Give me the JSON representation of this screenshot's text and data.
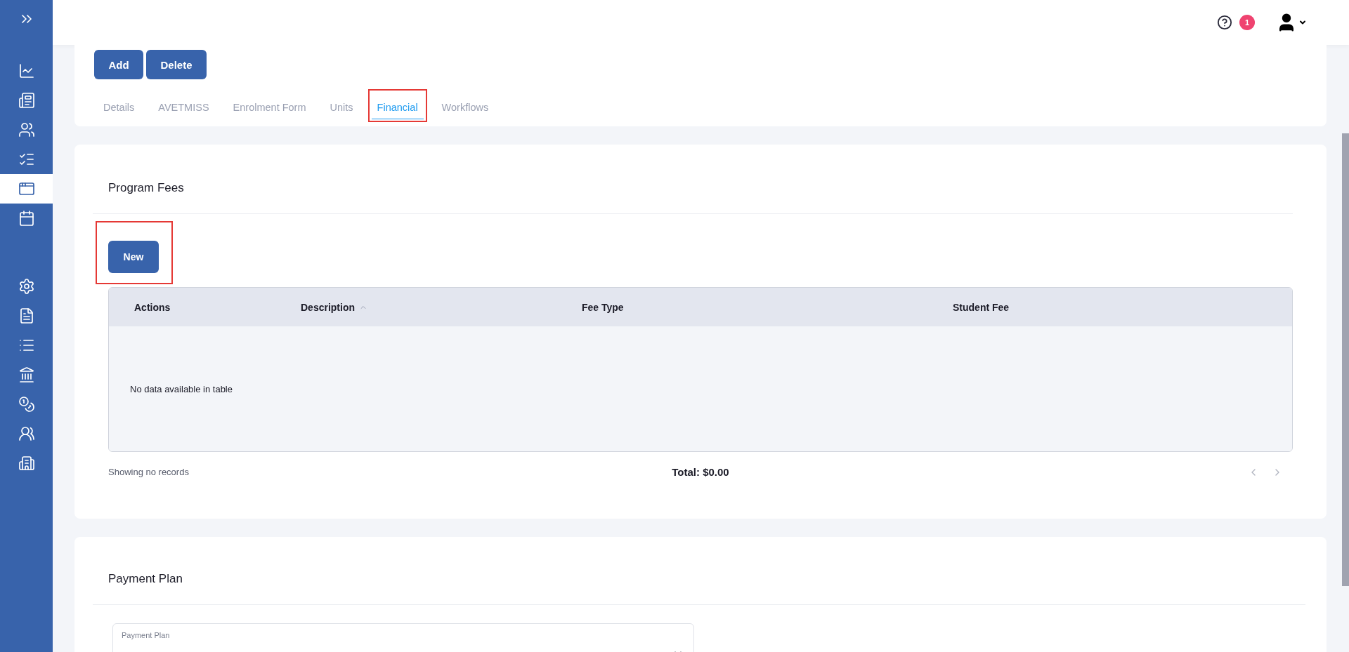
{
  "sidebar": {
    "items": [
      {
        "selected": false
      },
      {
        "selected": false
      },
      {
        "selected": false
      },
      {
        "selected": false
      },
      {
        "selected": false
      },
      {
        "selected": true
      },
      {
        "selected": false
      },
      {
        "selected": false
      },
      {
        "selected": false
      },
      {
        "selected": false
      },
      {
        "selected": false
      },
      {
        "selected": false
      },
      {
        "selected": false
      },
      {
        "selected": false
      }
    ]
  },
  "top_bar": {
    "notification_count": "1"
  },
  "header": {
    "buttons": [
      "Add",
      "Delete"
    ],
    "tabs": [
      {
        "label": "Details",
        "selected": false,
        "highlighted": false
      },
      {
        "label": "AVETMISS",
        "selected": false,
        "highlighted": false
      },
      {
        "label": "Enrolment Form",
        "selected": false,
        "highlighted": false
      },
      {
        "label": "Units",
        "selected": false,
        "highlighted": false
      },
      {
        "label": "Financial",
        "selected": true,
        "highlighted": true
      },
      {
        "label": "Workflows",
        "selected": false,
        "highlighted": false
      }
    ]
  },
  "program_fees": {
    "title": "Program Fees",
    "new_button": {
      "label": "New",
      "highlighted": true
    },
    "table": {
      "columns": [
        {
          "label": "Actions",
          "sorted": false
        },
        {
          "label": "Description",
          "sorted": true
        },
        {
          "label": "Fee Type",
          "sorted": false
        },
        {
          "label": "Student Fee",
          "sorted": false
        }
      ],
      "empty_text": "No data available in table"
    },
    "footer": {
      "records": "Showing no records",
      "total": "Total: $0.00"
    }
  },
  "payment_plan": {
    "title": "Payment Plan",
    "select": {
      "label": "Payment Plan"
    }
  }
}
